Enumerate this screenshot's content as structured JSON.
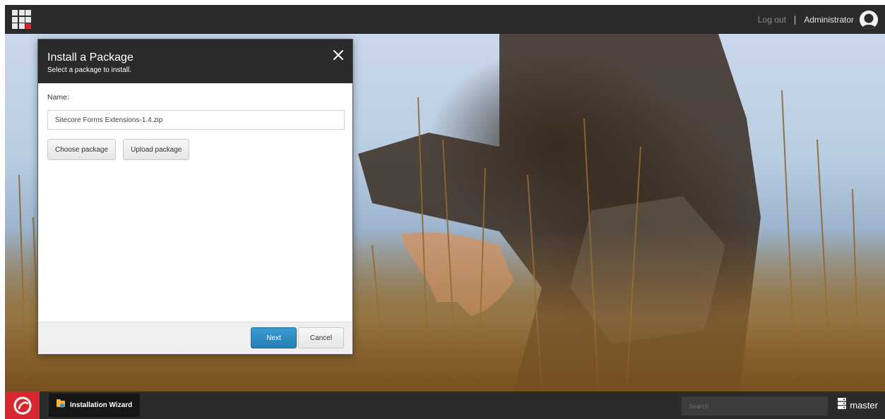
{
  "topbar": {
    "logout_label": "Log out",
    "separator": "|",
    "username": "Administrator",
    "launcher_icon": "app-grid-icon",
    "avatar_icon": "user-avatar-icon"
  },
  "dialog": {
    "title": "Install a Package",
    "subtitle": "Select a package to install.",
    "close_icon": "close-icon",
    "name_label": "Name:",
    "name_value": "Sitecore Forms Extensions-1.4.zip",
    "choose_label": "Choose package",
    "upload_label": "Upload package",
    "next_label": "Next",
    "cancel_label": "Cancel"
  },
  "taskbar": {
    "start_icon": "sitecore-logo-icon",
    "task_icon": "package-icon",
    "task_label": "Installation Wizard",
    "search_placeholder": "Search",
    "db_icon": "database-icon",
    "db_label": "master"
  },
  "colors": {
    "bar": "#2b2b2b",
    "brand_red": "#d7282f",
    "primary_blue": "#2a8bc4",
    "dialog_header": "#2b2b2b"
  }
}
